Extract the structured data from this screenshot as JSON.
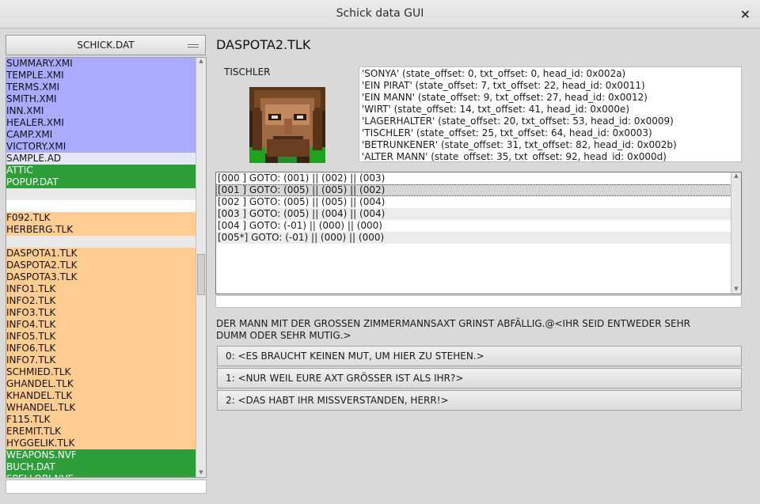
{
  "window": {
    "title": "Schick data GUI",
    "close_icon": "×"
  },
  "archive_select": {
    "value": "SCHICK.DAT"
  },
  "file_list": [
    {
      "label": "SUMMARY.XMI",
      "color": "blue"
    },
    {
      "label": "TEMPLE.XMI",
      "color": "blue"
    },
    {
      "label": "TERMS.XMI",
      "color": "blue"
    },
    {
      "label": "SMITH.XMI",
      "color": "blue"
    },
    {
      "label": "INN.XMI",
      "color": "blue"
    },
    {
      "label": "HEALER.XMI",
      "color": "blue"
    },
    {
      "label": "CAMP.XMI",
      "color": "blue"
    },
    {
      "label": "VICTORY.XMI",
      "color": "blue"
    },
    {
      "label": "SAMPLE.AD",
      "color": "lav"
    },
    {
      "label": "ATTIC",
      "color": "green"
    },
    {
      "label": "POPUP.DAT",
      "color": "green"
    },
    {
      "label": "",
      "color": "grey"
    },
    {
      "label": "",
      "color": "white"
    },
    {
      "label": "F092.TLK",
      "color": "orange"
    },
    {
      "label": "HERBERG.TLK",
      "color": "orange"
    },
    {
      "label": "",
      "color": "grey"
    },
    {
      "label": "DASPOTA1.TLK",
      "color": "orange"
    },
    {
      "label": "DASPOTA2.TLK",
      "color": "orange"
    },
    {
      "label": "DASPOTA3.TLK",
      "color": "orange"
    },
    {
      "label": "INFO1.TLK",
      "color": "orange"
    },
    {
      "label": "INFO2.TLK",
      "color": "orange"
    },
    {
      "label": "INFO3.TLK",
      "color": "orange"
    },
    {
      "label": "INFO4.TLK",
      "color": "orange"
    },
    {
      "label": "INFO5.TLK",
      "color": "orange"
    },
    {
      "label": "INFO6.TLK",
      "color": "orange"
    },
    {
      "label": "INFO7.TLK",
      "color": "orange"
    },
    {
      "label": "SCHMIED.TLK",
      "color": "orange"
    },
    {
      "label": "GHANDEL.TLK",
      "color": "orange"
    },
    {
      "label": "KHANDEL.TLK",
      "color": "orange"
    },
    {
      "label": "WHANDEL.TLK",
      "color": "orange"
    },
    {
      "label": "F115.TLK",
      "color": "orange"
    },
    {
      "label": "EREMIT.TLK",
      "color": "orange"
    },
    {
      "label": "HYGGELIK.TLK",
      "color": "orange"
    },
    {
      "label": "WEAPONS.NVF",
      "color": "green"
    },
    {
      "label": "BUCH.DAT",
      "color": "green"
    },
    {
      "label": "SPELLOBJ.NVF",
      "color": "green"
    }
  ],
  "file_title": "DASPOTA2.TLK",
  "speaker_name": "TISCHLER",
  "partners": [
    "'SONYA' (state_offset: 0, txt_offset: 0, head_id: 0x002a)",
    "'EIN PIRAT' (state_offset: 7, txt_offset: 22, head_id: 0x0011)",
    "'EIN MANN' (state_offset: 9, txt_offset: 27, head_id: 0x0012)",
    "'WIRT' (state_offset: 14, txt_offset: 41, head_id: 0x000e)",
    "'LAGERHALTER' (state_offset: 20, txt_offset: 53, head_id: 0x0009)",
    "'TISCHLER' (state_offset: 25, txt_offset: 64, head_id: 0x0003)",
    "'BETRUNKENER' (state_offset: 31, txt_offset: 82, head_id: 0x002b)",
    "'ALTER MANN' (state_offset: 35, txt_offset: 92, head_id: 0x000d)"
  ],
  "states": [
    {
      "text": "[000 ] GOTO: (001) || (002) || (003)",
      "selected": false
    },
    {
      "text": "[001 ] GOTO: (005) || (005) || (002)",
      "selected": true
    },
    {
      "text": "[002 ] GOTO: (005) || (005) || (004)",
      "selected": false
    },
    {
      "text": "[003 ] GOTO: (005) || (004) || (004)",
      "selected": false
    },
    {
      "text": "[004 ] GOTO: (-01) || (000) || (000)",
      "selected": false
    },
    {
      "text": "[005*] GOTO: (-01) || (000) || (000)",
      "selected": false
    }
  ],
  "dialog_text": "DER MANN MIT DER GROSSEN ZIMMERMANNSAXT GRINST ABFÄLLIG.@<IHR SEID ENTWEDER SEHR DUMM ODER SEHR MUTIG.>",
  "answers": [
    "0: <ES BRAUCHT KEINEN MUT, UM HIER ZU STEHEN.>",
    "1: <NUR WEIL EURE AXT GRÖSSER IST ALS IHR?>",
    "2: <DAS HABT IHR MISSVERSTANDEN, HERR!>"
  ],
  "colors": {
    "blue": "#aaaaff",
    "lav": "#e6e6fa",
    "green": "#2e9e3a",
    "orange": "#ffcc91",
    "grey": "#e9e9e9",
    "white": "#ffffff"
  }
}
